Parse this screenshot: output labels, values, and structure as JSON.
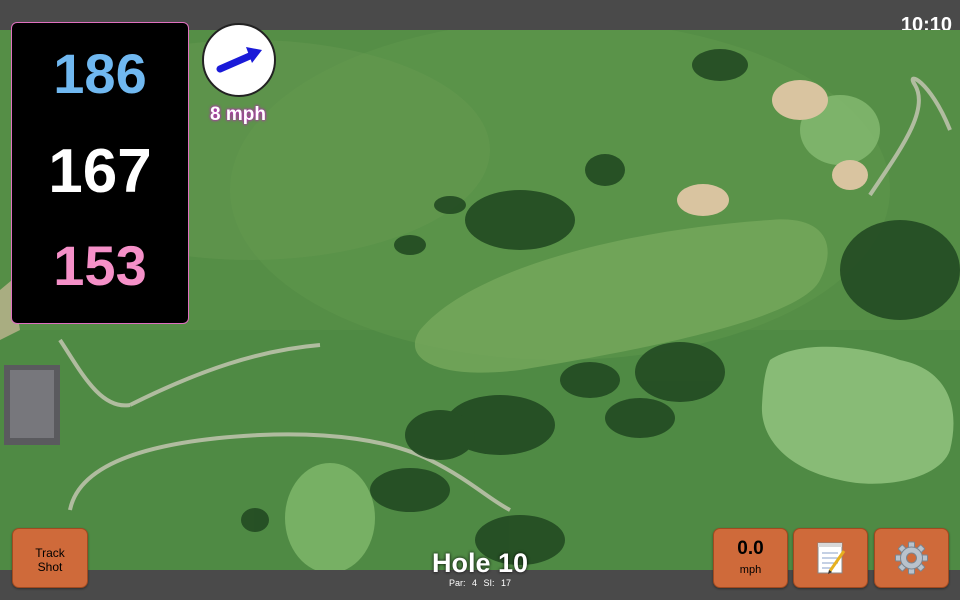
{
  "status": {
    "time": "10:10"
  },
  "distances": {
    "back": "186",
    "middle": "167",
    "front": "153"
  },
  "distance_colors": {
    "back": "#70b8f0",
    "middle": "#ffffff",
    "front": "#f590c8"
  },
  "wind": {
    "speed_label": "8 mph",
    "arrow_icon": "arrow-icon"
  },
  "buttons": {
    "track_shot_line1": "Track",
    "track_shot_line2": "Shot",
    "speed_value": "0.0",
    "speed_unit": "mph",
    "notes_icon": "notepad-icon",
    "settings_icon": "gear-icon"
  },
  "hole": {
    "title": "Hole 10",
    "par": "Par: 4",
    "si": "SI: 17"
  },
  "colors": {
    "accent_button": "#cf6a3a",
    "bar": "#4a4a4a"
  }
}
